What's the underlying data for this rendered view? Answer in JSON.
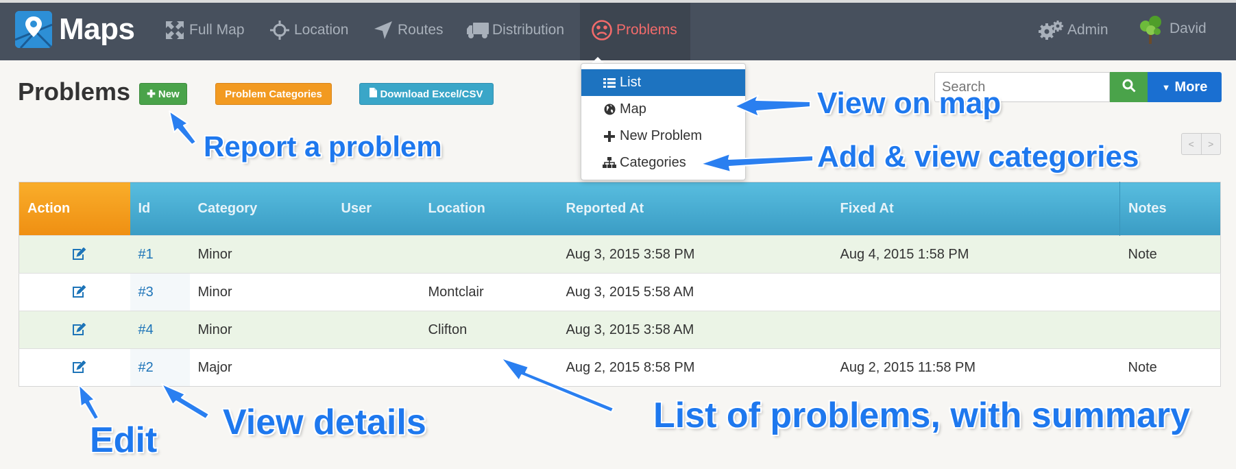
{
  "app": {
    "brand": "Maps"
  },
  "nav": [
    {
      "label": "Full Map",
      "icon": "expand-icon"
    },
    {
      "label": "Location",
      "icon": "crosshair-icon"
    },
    {
      "label": "Routes",
      "icon": "location-arrow-icon"
    },
    {
      "label": "Distribution",
      "icon": "truck-icon"
    },
    {
      "label": "Problems",
      "icon": "frown-icon",
      "active": true
    }
  ],
  "user_nav": [
    {
      "label": "Admin",
      "icon": "gears-icon"
    },
    {
      "label": "David",
      "icon": "tree-avatar-icon"
    }
  ],
  "page": {
    "title": "Problems",
    "buttons": {
      "new": "New",
      "categories": "Problem Categories",
      "download": "Download Excel/CSV"
    }
  },
  "search": {
    "placeholder": "Search",
    "more": "More"
  },
  "pager": {
    "prev": "<",
    "next": ">"
  },
  "dropdown": [
    {
      "label": "List",
      "icon": "list-icon",
      "active": true
    },
    {
      "label": "Map",
      "icon": "globe-icon"
    },
    {
      "label": "New Problem",
      "icon": "plus-icon"
    },
    {
      "label": "Categories",
      "icon": "sitemap-icon"
    }
  ],
  "table": {
    "columns": [
      "Action",
      "Id",
      "Category",
      "User",
      "Location",
      "Reported At",
      "Fixed At",
      "Notes"
    ],
    "rows": [
      {
        "id": "#1",
        "category": "Minor",
        "user": "",
        "location": "",
        "reported": "Aug 3, 2015 3:58 PM",
        "fixed": "Aug 4, 2015 1:58 PM",
        "notes": "Note"
      },
      {
        "id": "#3",
        "category": "Minor",
        "user": "",
        "location": "Montclair",
        "reported": "Aug 3, 2015 5:58 AM",
        "fixed": "",
        "notes": ""
      },
      {
        "id": "#4",
        "category": "Minor",
        "user": "",
        "location": "Clifton",
        "reported": "Aug 3, 2015 3:58 AM",
        "fixed": "",
        "notes": ""
      },
      {
        "id": "#2",
        "category": "Major",
        "user": "",
        "location": "",
        "reported": "Aug 2, 2015 8:58 PM",
        "fixed": "Aug 2, 2015 11:58 PM",
        "notes": "Note"
      }
    ]
  },
  "annotations": {
    "view_on_map": "View on map",
    "report": "Report a problem",
    "categories": "Add & view categories",
    "edit": "Edit",
    "details": "View details",
    "list": "List of problems, with summary"
  },
  "colors": {
    "navbar": "#47505d",
    "active_nav": "#f26b6b",
    "annotation": "#1e78ee",
    "table_header": "#4bb0d8",
    "action_header": "#f4a11f"
  }
}
